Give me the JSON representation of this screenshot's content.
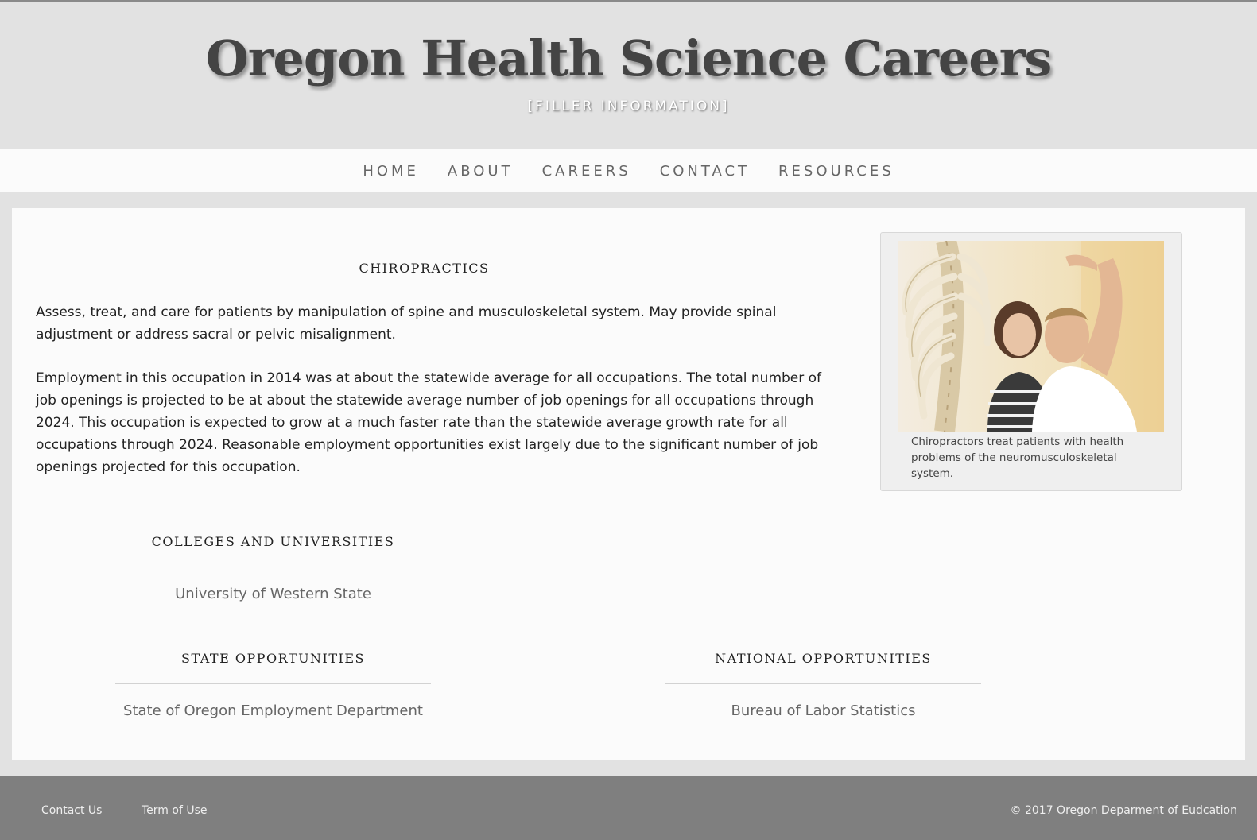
{
  "header": {
    "title": "Oregon Health Science Careers",
    "subtitle": "[FILLER INFORMATION]"
  },
  "nav": {
    "items": [
      {
        "label": "HOME"
      },
      {
        "label": "ABOUT"
      },
      {
        "label": "CAREERS"
      },
      {
        "label": "CONTACT"
      },
      {
        "label": "RESOURCES"
      }
    ]
  },
  "career": {
    "heading": "CHIROPRACTICS",
    "description": "Assess, treat, and care for patients by manipulation of spine and musculoskeletal system. May provide spinal adjustment or address sacral or pelvic misalignment.",
    "outlook": "Employment in this occupation in 2014 was at about the statewide average for all occupations. The total number of job openings is projected to be at about the statewide average number of job openings for all occupations through 2024. This occupation is expected to grow at a much faster rate than the statewide average growth rate for all occupations through 2024. Reasonable employment opportunities exist largely due to the significant number of job openings projected for this occupation."
  },
  "figure": {
    "caption": "Chiropractors treat patients with health problems of the neuromusculoskeletal system."
  },
  "colleges": {
    "heading": "COLLEGES AND UNIVERSITIES",
    "items": [
      "University of Western State"
    ]
  },
  "state": {
    "heading": "STATE OPPORTUNITIES",
    "items": [
      "State of Oregon Employment Department"
    ]
  },
  "national": {
    "heading": "NATIONAL OPPORTUNITIES",
    "items": [
      "Bureau of Labor Statistics"
    ]
  },
  "footer": {
    "contact_label": "Contact Us",
    "terms_label": "Term of Use",
    "copyright": "© 2017 Oregon Deparment of Eudcation"
  },
  "colors": {
    "page_bg": "#e2e2e2",
    "content_bg": "#fbfbfb",
    "footer_bg": "#7f7f7f",
    "title": "#444444",
    "nav_text": "#666666"
  }
}
